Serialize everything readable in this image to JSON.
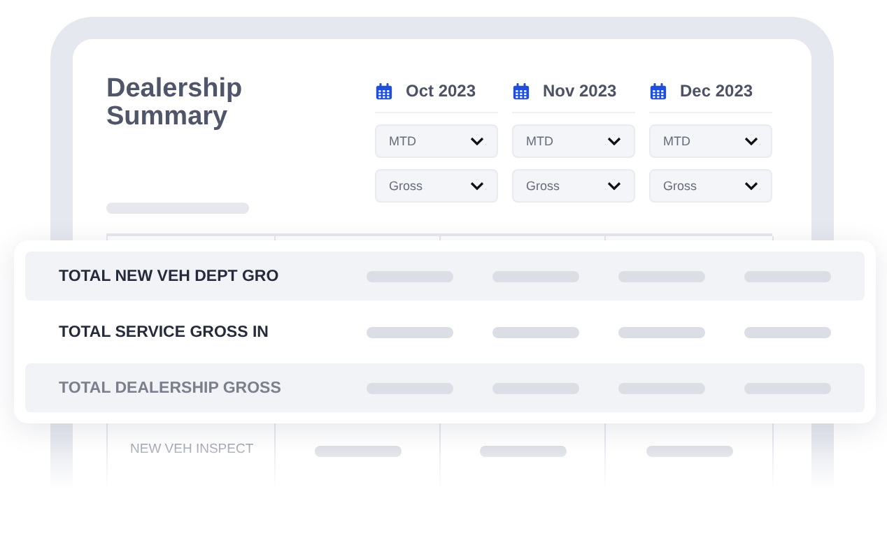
{
  "title": "Dealership Summary",
  "months": [
    {
      "label": "Oct 2023",
      "period": "MTD",
      "metric": "Gross"
    },
    {
      "label": "Nov 2023",
      "period": "MTD",
      "metric": "Gross"
    },
    {
      "label": "Dec 2023",
      "period": "MTD",
      "metric": "Gross"
    }
  ],
  "table": {
    "rows": [
      {
        "label": "NEW VEH INSPECT"
      }
    ]
  },
  "summary_rows": [
    {
      "label": "TOTAL NEW VEH DEPT GRO",
      "highlighted": true,
      "muted": false
    },
    {
      "label": "TOTAL SERVICE GROSS IN",
      "highlighted": false,
      "muted": false
    },
    {
      "label": "TOTAL DEALERSHIP GROSS",
      "highlighted": true,
      "muted": true
    }
  ]
}
